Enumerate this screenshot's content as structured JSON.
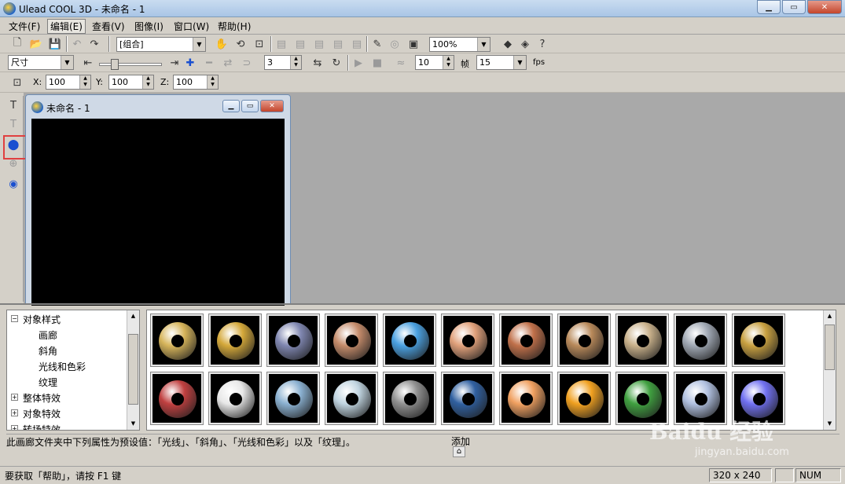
{
  "app": {
    "title": "Ulead COOL 3D - 未命名 - 1"
  },
  "menu": [
    "文件(F)",
    "编辑(E)",
    "查看(V)",
    "图像(I)",
    "窗口(W)",
    "帮助(H)"
  ],
  "toolbar1": {
    "object_combo": "[组合]",
    "zoom": "100%"
  },
  "toolbar2": {
    "property_combo": "尺寸",
    "spin_a": "3",
    "spin_b": "10",
    "frame_label": "帧",
    "fps_value": "15",
    "fps_label": "fps"
  },
  "toolbar3": {
    "x_label": "X:",
    "x_value": "100",
    "y_label": "Y:",
    "y_value": "100",
    "z_label": "Z:",
    "z_value": "100"
  },
  "child_window": {
    "title": "未命名 - 1"
  },
  "tree": {
    "items": [
      {
        "label": "对象样式",
        "expander": "−"
      },
      {
        "label": "画廊"
      },
      {
        "label": "斜角"
      },
      {
        "label": "光线和色彩"
      },
      {
        "label": "纹理"
      },
      {
        "label": "整体特效",
        "expander": "+"
      },
      {
        "label": "对象特效",
        "expander": "+"
      },
      {
        "label": "转场特效",
        "expander": "+"
      }
    ]
  },
  "gallery": {
    "row1": [
      "#d6b45a",
      "#d4a83a",
      "#7f86b0",
      "#c48b6a",
      "#4aa0e0",
      "#e0a07a",
      "#c0704a",
      "#b8895a",
      "#c8b08a",
      "#a0a8b4",
      "#c8a040"
    ],
    "row2": [
      "#c04040",
      "#e8e8e8",
      "#8ab0d0",
      "#c0d4e0",
      "#909090",
      "#3060a0",
      "#f0a060",
      "#f0a020",
      "#40a040",
      "#b0c0e0",
      "#7070f0"
    ]
  },
  "info": {
    "text": "此画廊文件夹中下列属性为预设值：「光线」、「斜角」、「光线和色彩」以及「纹理」。",
    "add_label": "添加"
  },
  "status": {
    "help": "要获取「帮助」，请按 F1 键",
    "size": "320 x 240",
    "num": "NUM"
  },
  "watermark": {
    "brand": "Baidu 经验",
    "url": "jingyan.baidu.com"
  },
  "colors": {
    "highlight": "#e04040",
    "workspace": "#a9a9a9"
  }
}
